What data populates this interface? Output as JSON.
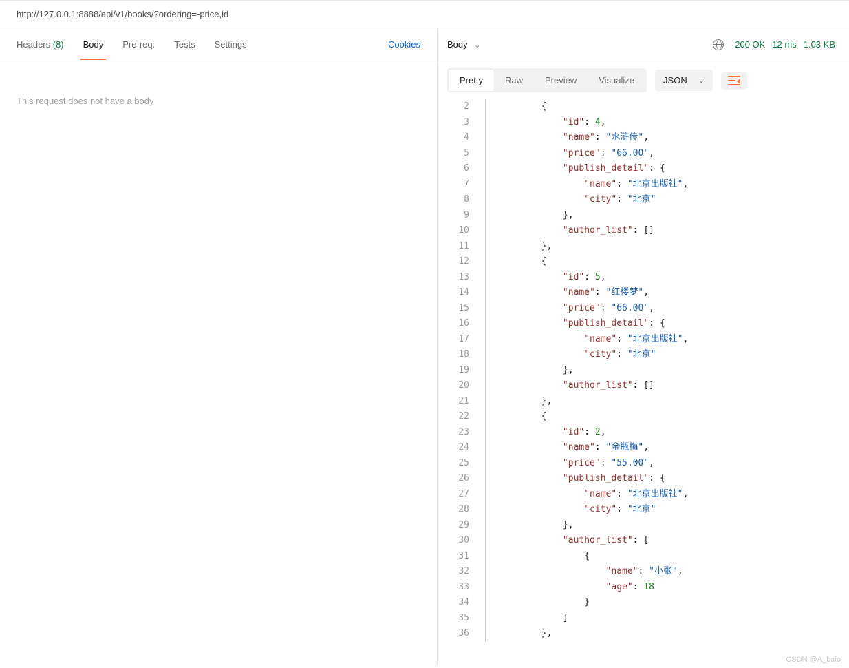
{
  "url": "http://127.0.0.1:8888/api/v1/books/?ordering=-price,id",
  "left_tabs": [
    {
      "label": "Headers",
      "count": "(8)",
      "key": "headers"
    },
    {
      "label": "Body",
      "key": "body",
      "active": true
    },
    {
      "label": "Pre-req.",
      "key": "prereq"
    },
    {
      "label": "Tests",
      "key": "tests"
    },
    {
      "label": "Settings",
      "key": "settings"
    }
  ],
  "cookies_label": "Cookies",
  "no_body_msg": "This request does not have a body",
  "response": {
    "body_label": "Body",
    "status": "200 OK",
    "time": "12 ms",
    "size": "1.03 KB",
    "view_tabs": [
      {
        "label": "Pretty",
        "active": true
      },
      {
        "label": "Raw"
      },
      {
        "label": "Preview"
      },
      {
        "label": "Visualize"
      }
    ],
    "format": "JSON"
  },
  "code_lines": [
    {
      "n": 2,
      "indent": 2,
      "tokens": [
        {
          "t": "punc",
          "v": "{"
        }
      ]
    },
    {
      "n": 3,
      "indent": 3,
      "tokens": [
        {
          "t": "key",
          "v": "\"id\""
        },
        {
          "t": "punc",
          "v": ": "
        },
        {
          "t": "num",
          "v": "4"
        },
        {
          "t": "punc",
          "v": ","
        }
      ]
    },
    {
      "n": 4,
      "indent": 3,
      "tokens": [
        {
          "t": "key",
          "v": "\"name\""
        },
        {
          "t": "punc",
          "v": ": "
        },
        {
          "t": "str",
          "v": "\"水浒传\""
        },
        {
          "t": "punc",
          "v": ","
        }
      ]
    },
    {
      "n": 5,
      "indent": 3,
      "tokens": [
        {
          "t": "key",
          "v": "\"price\""
        },
        {
          "t": "punc",
          "v": ": "
        },
        {
          "t": "str",
          "v": "\"66.00\""
        },
        {
          "t": "punc",
          "v": ","
        }
      ]
    },
    {
      "n": 6,
      "indent": 3,
      "tokens": [
        {
          "t": "key",
          "v": "\"publish_detail\""
        },
        {
          "t": "punc",
          "v": ": "
        },
        {
          "t": "punc",
          "v": "{"
        }
      ]
    },
    {
      "n": 7,
      "indent": 4,
      "tokens": [
        {
          "t": "key",
          "v": "\"name\""
        },
        {
          "t": "punc",
          "v": ": "
        },
        {
          "t": "str",
          "v": "\"北京出版社\""
        },
        {
          "t": "punc",
          "v": ","
        }
      ]
    },
    {
      "n": 8,
      "indent": 4,
      "tokens": [
        {
          "t": "key",
          "v": "\"city\""
        },
        {
          "t": "punc",
          "v": ": "
        },
        {
          "t": "str",
          "v": "\"北京\""
        }
      ]
    },
    {
      "n": 9,
      "indent": 3,
      "tokens": [
        {
          "t": "punc",
          "v": "}"
        },
        {
          "t": "punc",
          "v": ","
        }
      ]
    },
    {
      "n": 10,
      "indent": 3,
      "tokens": [
        {
          "t": "key",
          "v": "\"author_list\""
        },
        {
          "t": "punc",
          "v": ": "
        },
        {
          "t": "punc",
          "v": "[]"
        }
      ]
    },
    {
      "n": 11,
      "indent": 2,
      "tokens": [
        {
          "t": "punc",
          "v": "}"
        },
        {
          "t": "punc",
          "v": ","
        }
      ]
    },
    {
      "n": 12,
      "indent": 2,
      "tokens": [
        {
          "t": "punc",
          "v": "{"
        }
      ]
    },
    {
      "n": 13,
      "indent": 3,
      "tokens": [
        {
          "t": "key",
          "v": "\"id\""
        },
        {
          "t": "punc",
          "v": ": "
        },
        {
          "t": "num",
          "v": "5"
        },
        {
          "t": "punc",
          "v": ","
        }
      ]
    },
    {
      "n": 14,
      "indent": 3,
      "tokens": [
        {
          "t": "key",
          "v": "\"name\""
        },
        {
          "t": "punc",
          "v": ": "
        },
        {
          "t": "str",
          "v": "\"红楼梦\""
        },
        {
          "t": "punc",
          "v": ","
        }
      ]
    },
    {
      "n": 15,
      "indent": 3,
      "tokens": [
        {
          "t": "key",
          "v": "\"price\""
        },
        {
          "t": "punc",
          "v": ": "
        },
        {
          "t": "str",
          "v": "\"66.00\""
        },
        {
          "t": "punc",
          "v": ","
        }
      ]
    },
    {
      "n": 16,
      "indent": 3,
      "tokens": [
        {
          "t": "key",
          "v": "\"publish_detail\""
        },
        {
          "t": "punc",
          "v": ": "
        },
        {
          "t": "punc",
          "v": "{"
        }
      ]
    },
    {
      "n": 17,
      "indent": 4,
      "tokens": [
        {
          "t": "key",
          "v": "\"name\""
        },
        {
          "t": "punc",
          "v": ": "
        },
        {
          "t": "str",
          "v": "\"北京出版社\""
        },
        {
          "t": "punc",
          "v": ","
        }
      ]
    },
    {
      "n": 18,
      "indent": 4,
      "tokens": [
        {
          "t": "key",
          "v": "\"city\""
        },
        {
          "t": "punc",
          "v": ": "
        },
        {
          "t": "str",
          "v": "\"北京\""
        }
      ]
    },
    {
      "n": 19,
      "indent": 3,
      "tokens": [
        {
          "t": "punc",
          "v": "}"
        },
        {
          "t": "punc",
          "v": ","
        }
      ]
    },
    {
      "n": 20,
      "indent": 3,
      "tokens": [
        {
          "t": "key",
          "v": "\"author_list\""
        },
        {
          "t": "punc",
          "v": ": "
        },
        {
          "t": "punc",
          "v": "[]"
        }
      ]
    },
    {
      "n": 21,
      "indent": 2,
      "tokens": [
        {
          "t": "punc",
          "v": "}"
        },
        {
          "t": "punc",
          "v": ","
        }
      ]
    },
    {
      "n": 22,
      "indent": 2,
      "tokens": [
        {
          "t": "punc",
          "v": "{"
        }
      ]
    },
    {
      "n": 23,
      "indent": 3,
      "tokens": [
        {
          "t": "key",
          "v": "\"id\""
        },
        {
          "t": "punc",
          "v": ": "
        },
        {
          "t": "num",
          "v": "2"
        },
        {
          "t": "punc",
          "v": ","
        }
      ]
    },
    {
      "n": 24,
      "indent": 3,
      "tokens": [
        {
          "t": "key",
          "v": "\"name\""
        },
        {
          "t": "punc",
          "v": ": "
        },
        {
          "t": "str",
          "v": "\"金瓶梅\""
        },
        {
          "t": "punc",
          "v": ","
        }
      ]
    },
    {
      "n": 25,
      "indent": 3,
      "tokens": [
        {
          "t": "key",
          "v": "\"price\""
        },
        {
          "t": "punc",
          "v": ": "
        },
        {
          "t": "str",
          "v": "\"55.00\""
        },
        {
          "t": "punc",
          "v": ","
        }
      ]
    },
    {
      "n": 26,
      "indent": 3,
      "tokens": [
        {
          "t": "key",
          "v": "\"publish_detail\""
        },
        {
          "t": "punc",
          "v": ": "
        },
        {
          "t": "punc",
          "v": "{"
        }
      ]
    },
    {
      "n": 27,
      "indent": 4,
      "tokens": [
        {
          "t": "key",
          "v": "\"name\""
        },
        {
          "t": "punc",
          "v": ": "
        },
        {
          "t": "str",
          "v": "\"北京出版社\""
        },
        {
          "t": "punc",
          "v": ","
        }
      ]
    },
    {
      "n": 28,
      "indent": 4,
      "tokens": [
        {
          "t": "key",
          "v": "\"city\""
        },
        {
          "t": "punc",
          "v": ": "
        },
        {
          "t": "str",
          "v": "\"北京\""
        }
      ]
    },
    {
      "n": 29,
      "indent": 3,
      "tokens": [
        {
          "t": "punc",
          "v": "}"
        },
        {
          "t": "punc",
          "v": ","
        }
      ]
    },
    {
      "n": 30,
      "indent": 3,
      "tokens": [
        {
          "t": "key",
          "v": "\"author_list\""
        },
        {
          "t": "punc",
          "v": ": "
        },
        {
          "t": "punc",
          "v": "["
        }
      ]
    },
    {
      "n": 31,
      "indent": 4,
      "tokens": [
        {
          "t": "punc",
          "v": "{"
        }
      ]
    },
    {
      "n": 32,
      "indent": 5,
      "tokens": [
        {
          "t": "key",
          "v": "\"name\""
        },
        {
          "t": "punc",
          "v": ": "
        },
        {
          "t": "str",
          "v": "\"小张\""
        },
        {
          "t": "punc",
          "v": ","
        }
      ]
    },
    {
      "n": 33,
      "indent": 5,
      "tokens": [
        {
          "t": "key",
          "v": "\"age\""
        },
        {
          "t": "punc",
          "v": ": "
        },
        {
          "t": "num",
          "v": "18"
        }
      ]
    },
    {
      "n": 34,
      "indent": 4,
      "tokens": [
        {
          "t": "punc",
          "v": "}"
        }
      ]
    },
    {
      "n": 35,
      "indent": 3,
      "tokens": [
        {
          "t": "punc",
          "v": "]"
        }
      ]
    },
    {
      "n": 36,
      "indent": 2,
      "tokens": [
        {
          "t": "punc",
          "v": "}"
        },
        {
          "t": "punc",
          "v": ","
        }
      ]
    }
  ],
  "watermark": "CSDN @A_baio"
}
